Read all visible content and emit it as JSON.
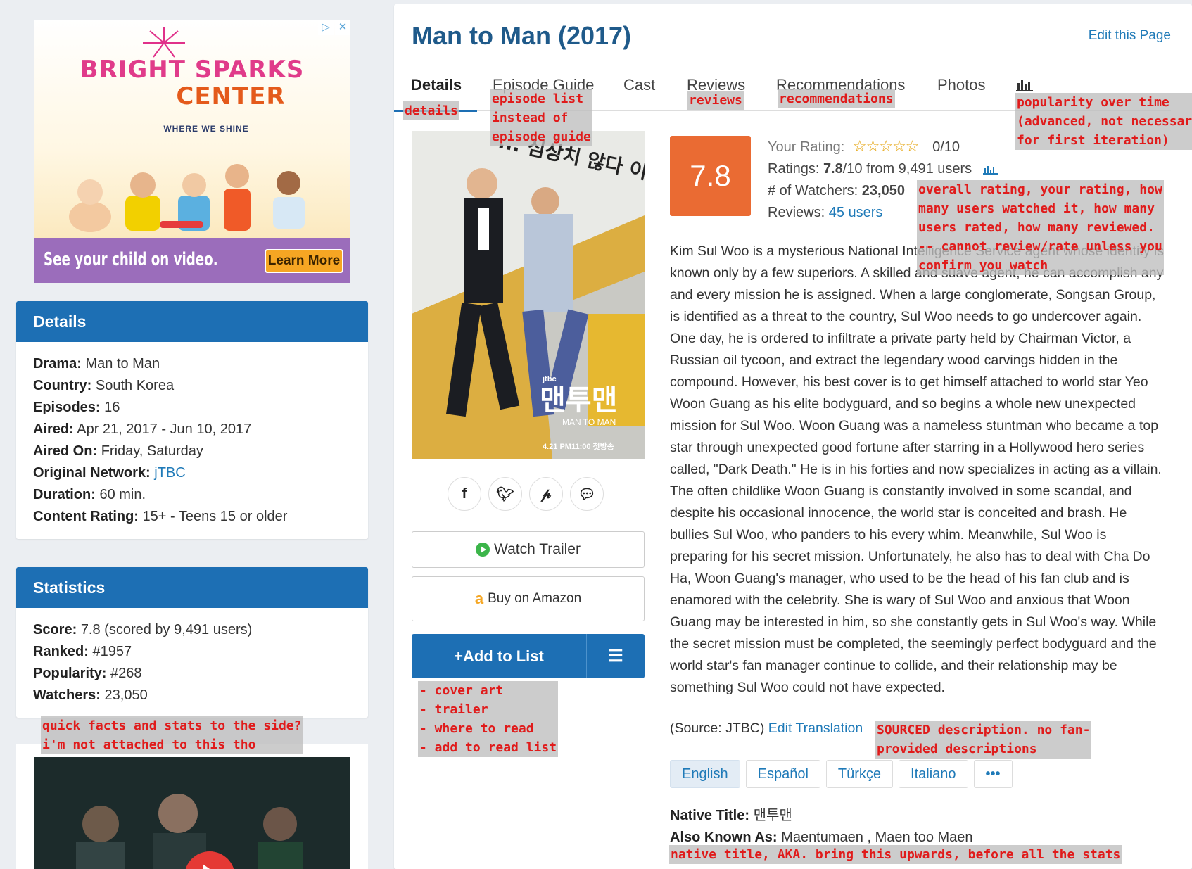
{
  "ad": {
    "close_icons": [
      "ad-choices-icon",
      "close-icon"
    ],
    "title_line1": "BRIGHT SPARKS",
    "title_line2": "CENTER",
    "subtitle": "WHERE WE SHINE",
    "tagline": "See your child on video.",
    "cta": "Learn More"
  },
  "details_panel": {
    "heading": "Details",
    "rows": [
      {
        "label": "Drama:",
        "value": "Man to Man"
      },
      {
        "label": "Country:",
        "value": "South Korea"
      },
      {
        "label": "Episodes:",
        "value": "16"
      },
      {
        "label": "Aired:",
        "value": "Apr 21, 2017 - Jun 10, 2017"
      },
      {
        "label": "Aired On:",
        "value": "Friday, Saturday"
      },
      {
        "label": "Original Network:",
        "value": "jTBC"
      },
      {
        "label": "Duration:",
        "value": "60 min."
      },
      {
        "label": "Content Rating:",
        "value": "15+ - Teens 15 or older"
      }
    ]
  },
  "stats_panel": {
    "heading": "Statistics",
    "rows": [
      {
        "label": "Score:",
        "value": "7.8 (scored by 9,491 users)"
      },
      {
        "label": "Ranked:",
        "value": "#1957"
      },
      {
        "label": "Popularity:",
        "value": "#268"
      },
      {
        "label": "Watchers:",
        "value": "23,050"
      }
    ]
  },
  "header": {
    "title": "Man to Man (2017)",
    "edit_link": "Edit this Page"
  },
  "tabs": [
    "Details",
    "Episode Guide",
    "Cast",
    "Reviews",
    "Recommendations",
    "Photos"
  ],
  "tab_chart_icon": "bar-chart-icon",
  "poster": {
    "korean_tagline": "... 심상치 않다 이 브로맨스!?",
    "logo": "맨투맨",
    "logo_sub": "MAN TO MAN",
    "date_text": "4.21 PM11:00 첫방송",
    "channel": "jtbc"
  },
  "share_icons": [
    "facebook-icon",
    "twitter-icon",
    "pinterest-icon",
    "comments-icon"
  ],
  "buttons": {
    "trailer": "Watch Trailer",
    "amazon": "Buy on Amazon",
    "add_list": "Add to List"
  },
  "rating": {
    "score": "7.8",
    "your_rating_label": "Your Rating:",
    "your_rating_value": "0/10",
    "ratings_label": "Ratings:",
    "ratings_score": "7.8",
    "ratings_rest": "/10 from 9,491 users",
    "watchers_label": "# of Watchers:",
    "watchers_value": "23,050",
    "reviews_label": "Reviews:",
    "reviews_value": "45 users"
  },
  "synopsis": "Kim Sul Woo is a mysterious National Intelligence Service agent whose identity is known only by a few superiors. A skilled and suave agent, he can accomplish any and every mission he is assigned. When a large conglomerate, Songsan Group, is identified as a threat to the country, Sul Woo needs to go undercover again. One day, he is ordered to infiltrate a private party held by Chairman Victor, a Russian oil tycoon, and extract the legendary wood carvings hidden in the compound. However, his best cover is to get himself attached to world star Yeo Woon Guang as his elite bodyguard, and so begins a whole new unexpected mission for Sul Woo. Woon Guang was a nameless stuntman who became a top star through unexpected good fortune after starring in a Hollywood hero series called, \"Dark Death.\" He is in his forties and now specializes in acting as a villain. The often childlike Woon Guang is constantly involved in some scandal, and despite his occasional innocence, the world star is conceited and brash. He bullies Sul Woo, who panders to his every whim. Meanwhile, Sul Woo is preparing for his secret mission. Unfortunately, he also has to deal with Cha Do Ha, Woon Guang's manager, who used to be the head of his fan club and is enamored with the celebrity. She is wary of Sul Woo and anxious that Woon Guang may be interested in him, so she constantly gets in Sul Woo's way. While the secret mission must be completed, the seemingly perfect bodyguard and the world star's fan manager continue to collide, and their relationship may be something Sul Woo could not have expected.",
  "source": "(Source: JTBC)",
  "edit_translation": "Edit Translation",
  "languages": [
    "English",
    "Español",
    "Türkçe",
    "Italiano",
    "•••"
  ],
  "native_title_label": "Native Title:",
  "native_title": "맨투맨",
  "aka_label": "Also Known As:",
  "aka": "Maentumaen , Maen too Maen",
  "annotations": {
    "details": "details",
    "episode": "episode list\ninstead of\nepisode guide",
    "reviews": "reviews",
    "recommendations": "recommendations",
    "popularity": "popularity over time\n(advanced, not necessary\nfor first iteration)",
    "rating": "overall rating, your rating, how\nmany users watched it, how many\nusers rated, how many reviewed.\n-- cannot review/rate unless you\nconfirm you watch",
    "sidebar": "quick facts and stats to the side?\ni'm not attached to this tho",
    "cover": "- cover art\n- trailer\n- where to read\n- add to read list",
    "sourced": "SOURCED description. no fan-\nprovided descriptions",
    "native": "native title, AKA. bring this upwards, before all the stats"
  }
}
